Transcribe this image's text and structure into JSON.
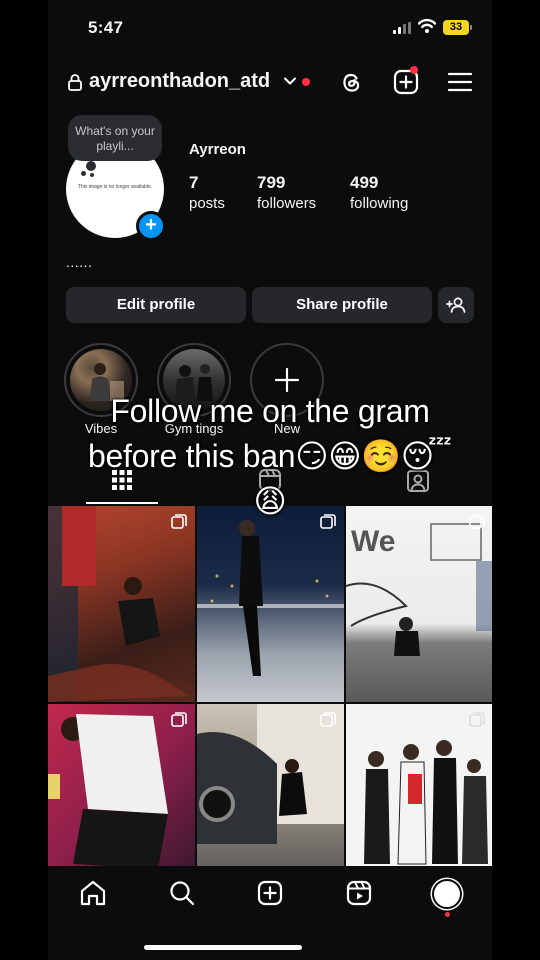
{
  "status": {
    "time": "5:47",
    "battery": "33"
  },
  "topnav": {
    "username": "ayrreonthadon_atd"
  },
  "profile": {
    "note": "What's on your playli...",
    "avatar_placeholder": "This image is no longer available.",
    "name": "Ayrreon",
    "bio": "......",
    "stats": [
      {
        "value": "7",
        "label": "posts"
      },
      {
        "value": "799",
        "label": "followers"
      },
      {
        "value": "499",
        "label": "following"
      }
    ]
  },
  "buttons": {
    "edit": "Edit profile",
    "share": "Share profile"
  },
  "highlights": [
    {
      "label": "Vibes"
    },
    {
      "label": "Gym tings"
    },
    {
      "label": "New"
    }
  ],
  "caption": {
    "line1": "Follow me on the gram",
    "line2": "before this ban😏😁☺️😴",
    "line3": "😩"
  },
  "colors": {
    "accent": "#0095f6",
    "notification": "#ff3040",
    "background": "#0c0c0d",
    "button": "#26272b"
  }
}
